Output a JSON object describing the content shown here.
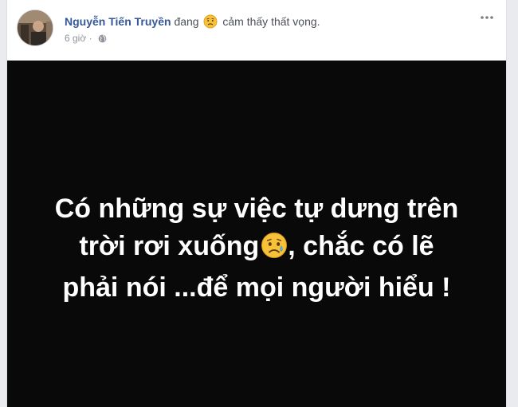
{
  "post": {
    "author": "Nguyễn Tiến Truyền",
    "status_prefix": "đang",
    "feeling": "cảm thấy thất vọng.",
    "feeling_icon": "disappointed-face-icon",
    "timestamp": "6 giờ",
    "privacy_icon": "globe-icon",
    "menu_icon": "more-options-icon"
  },
  "image_text": {
    "line1": "Có những sự việc tự dưng trên",
    "line2_before": "trời rơi xuống",
    "line2_emoji": "sad-crying-face-icon",
    "line2_after": ", chắc có lẽ",
    "line3": "phải nói ...để mọi người hiểu !"
  },
  "colors": {
    "author": "#365899",
    "image_background": "#090909",
    "image_text": "#ffffff"
  }
}
